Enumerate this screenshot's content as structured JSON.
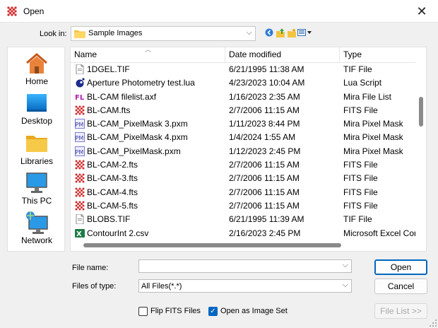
{
  "window": {
    "title": "Open",
    "close_glyph": "✕"
  },
  "lookin": {
    "label": "Look in:",
    "value": "Sample Images"
  },
  "toolbar_icons": [
    "back-icon",
    "up-folder-icon",
    "new-folder-icon",
    "view-menu-icon"
  ],
  "places": [
    {
      "label": "Home",
      "icon": "home-icon"
    },
    {
      "label": "Desktop",
      "icon": "desktop-icon"
    },
    {
      "label": "Libraries",
      "icon": "libraries-icon"
    },
    {
      "label": "This PC",
      "icon": "this-pc-icon"
    },
    {
      "label": "Network",
      "icon": "network-icon"
    }
  ],
  "columns": {
    "name": "Name",
    "date": "Date modified",
    "type": "Type"
  },
  "files": [
    {
      "name": "1DGEL.TIF",
      "date": "6/21/1995 11:38 AM",
      "type": "TIF File",
      "icon": "tif"
    },
    {
      "name": "Aperture Photometry test.lua",
      "date": "4/23/2023 10:04 AM",
      "type": "Lua Script",
      "icon": "lua"
    },
    {
      "name": "BL-CAM filelist.axf",
      "date": "1/16/2023 2:35 AM",
      "type": "Mira File List",
      "icon": "fl"
    },
    {
      "name": "BL-CAM.fts",
      "date": "2/7/2006 11:15 AM",
      "type": "FITS File",
      "icon": "fits"
    },
    {
      "name": "BL-CAM_PixelMask 3.pxm",
      "date": "1/11/2023 8:44 PM",
      "type": "Mira Pixel Mask",
      "icon": "pm"
    },
    {
      "name": "BL-CAM_PixelMask 4.pxm",
      "date": "1/4/2024 1:55 AM",
      "type": "Mira Pixel Mask",
      "icon": "pm"
    },
    {
      "name": "BL-CAM_PixelMask.pxm",
      "date": "1/12/2023 2:45 PM",
      "type": "Mira Pixel Mask",
      "icon": "pm"
    },
    {
      "name": "BL-CAM-2.fts",
      "date": "2/7/2006 11:15 AM",
      "type": "FITS File",
      "icon": "fits"
    },
    {
      "name": "BL-CAM-3.fts",
      "date": "2/7/2006 11:15 AM",
      "type": "FITS File",
      "icon": "fits"
    },
    {
      "name": "BL-CAM-4.fts",
      "date": "2/7/2006 11:15 AM",
      "type": "FITS File",
      "icon": "fits"
    },
    {
      "name": "BL-CAM-5.fts",
      "date": "2/7/2006 11:15 AM",
      "type": "FITS File",
      "icon": "fits"
    },
    {
      "name": "BLOBS.TIF",
      "date": "6/21/1995 11:39 AM",
      "type": "TIF File",
      "icon": "tif"
    },
    {
      "name": "ContourInt 2.csv",
      "date": "2/16/2023 2:45 PM",
      "type": "Microsoft Excel Com",
      "icon": "csv"
    }
  ],
  "filename": {
    "label": "File name:",
    "value": ""
  },
  "filetype": {
    "label": "Files of type:",
    "value": "All Files(*.*)"
  },
  "buttons": {
    "open": "Open",
    "cancel": "Cancel",
    "filelist": "File List  >>"
  },
  "options": {
    "flip_fits": {
      "label": "Flip FITS Files",
      "checked": false
    },
    "open_as_set": {
      "label": "Open as Image Set",
      "checked": true
    }
  },
  "colors": {
    "accent": "#0067c0",
    "fits_red": "#d42a2a",
    "folder": "#f5c342"
  }
}
